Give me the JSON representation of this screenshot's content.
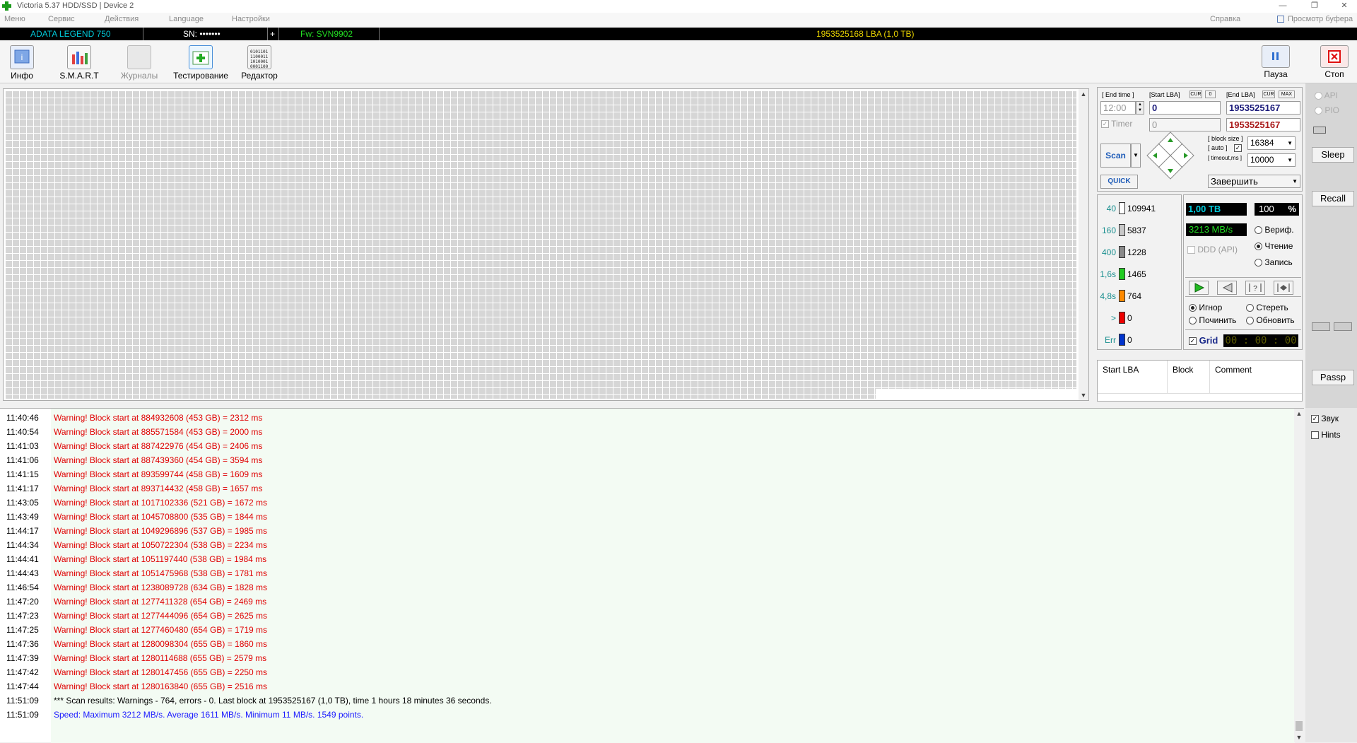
{
  "window": {
    "title": "Victoria 5.37 HDD/SSD | Device 2"
  },
  "menu": {
    "items": [
      "Меню",
      "Сервис",
      "Действия",
      "Language",
      "Настройки"
    ],
    "help": "Справка",
    "clipboard": "Просмотр буфера"
  },
  "device": {
    "model": "ADATA LEGEND 750",
    "sn": "SN: •••••••",
    "plus": "+",
    "fw": "Fw: SVN9902",
    "lba": "1953525168 LBA (1,0 TB)"
  },
  "toolbar": {
    "info": "Инфо",
    "smart": "S.M.A.R.T",
    "logs": "Журналы",
    "testing": "Тестирование",
    "editor": "Редактор",
    "pause": "Пауза",
    "stop": "Стоп"
  },
  "scan_panel": {
    "end_time_label": "[ End time ]",
    "start_lba_label": "[Start LBA]",
    "cur": "CUR",
    "zero": "0",
    "end_lba_label": "[End LBA]",
    "max": "MAX",
    "end_time": "12:00",
    "start_lba": "0",
    "end_lba": "1953525167",
    "timer_label": "Timer",
    "timer_value": "0",
    "end_lba2": "1953525167",
    "scan": "Scan",
    "quick": "QUICK",
    "block_size_label": "[ block size ]",
    "auto_label": "[ auto ]",
    "timeout_label": "[ timeout,ms ]",
    "block_size": "16384",
    "timeout": "10000",
    "finish": "Завершить"
  },
  "stats": [
    {
      "ms": "40",
      "count": "109941",
      "color": "#ffffff"
    },
    {
      "ms": "160",
      "count": "5837",
      "color": "#c8c8c8"
    },
    {
      "ms": "400",
      "count": "1228",
      "color": "#8a8a8a"
    },
    {
      "ms": "1,6s",
      "count": "1465",
      "color": "#22cc22"
    },
    {
      "ms": "4,8s",
      "count": "764",
      "color": "#ff8a00"
    },
    {
      "ms": ">",
      "count": "0",
      "color": "#ee0000"
    },
    {
      "ms": "Err",
      "count": "0",
      "color": "#0033cc"
    }
  ],
  "progress": {
    "size": "1,00 TB",
    "percent": "100",
    "pct_sign": "%",
    "speed": "3213 MB/s",
    "ddd": "DDD (API)"
  },
  "mode": {
    "verify": "Вериф.",
    "read": "Чтение",
    "write": "Запись"
  },
  "action": {
    "ignore": "Игнор",
    "erase": "Стереть",
    "repair": "Починить",
    "refresh": "Обновить"
  },
  "grid_label": "Grid",
  "timer_display": "00 : 00 : 00",
  "table": {
    "cols": [
      "Start LBA",
      "Block",
      "Comment"
    ]
  },
  "side": {
    "api": "API",
    "pio": "PIO",
    "sleep": "Sleep",
    "recall": "Recall",
    "passp": "Passp",
    "sound": "Звук",
    "hints": "Hints"
  },
  "log": [
    {
      "t": "11:40:46",
      "m": "Warning! Block start at 884932608 (453 GB)  = 2312 ms",
      "c": "#e00000"
    },
    {
      "t": "11:40:54",
      "m": "Warning! Block start at 885571584 (453 GB)  = 2000 ms",
      "c": "#e00000"
    },
    {
      "t": "11:41:03",
      "m": "Warning! Block start at 887422976 (454 GB)  = 2406 ms",
      "c": "#e00000"
    },
    {
      "t": "11:41:06",
      "m": "Warning! Block start at 887439360 (454 GB)  = 3594 ms",
      "c": "#e00000"
    },
    {
      "t": "11:41:15",
      "m": "Warning! Block start at 893599744 (458 GB)  = 1609 ms",
      "c": "#e00000"
    },
    {
      "t": "11:41:17",
      "m": "Warning! Block start at 893714432 (458 GB)  = 1657 ms",
      "c": "#e00000"
    },
    {
      "t": "11:43:05",
      "m": "Warning! Block start at 1017102336 (521 GB)  = 1672 ms",
      "c": "#e00000"
    },
    {
      "t": "11:43:49",
      "m": "Warning! Block start at 1045708800 (535 GB)  = 1844 ms",
      "c": "#e00000"
    },
    {
      "t": "11:44:17",
      "m": "Warning! Block start at 1049296896 (537 GB)  = 1985 ms",
      "c": "#e00000"
    },
    {
      "t": "11:44:34",
      "m": "Warning! Block start at 1050722304 (538 GB)  = 2234 ms",
      "c": "#e00000"
    },
    {
      "t": "11:44:41",
      "m": "Warning! Block start at 1051197440 (538 GB)  = 1984 ms",
      "c": "#e00000"
    },
    {
      "t": "11:44:43",
      "m": "Warning! Block start at 1051475968 (538 GB)  = 1781 ms",
      "c": "#e00000"
    },
    {
      "t": "11:46:54",
      "m": "Warning! Block start at 1238089728 (634 GB)  = 1828 ms",
      "c": "#e00000"
    },
    {
      "t": "11:47:20",
      "m": "Warning! Block start at 1277411328 (654 GB)  = 2469 ms",
      "c": "#e00000"
    },
    {
      "t": "11:47:23",
      "m": "Warning! Block start at 1277444096 (654 GB)  = 2625 ms",
      "c": "#e00000"
    },
    {
      "t": "11:47:25",
      "m": "Warning! Block start at 1277460480 (654 GB)  = 1719 ms",
      "c": "#e00000"
    },
    {
      "t": "11:47:36",
      "m": "Warning! Block start at 1280098304 (655 GB)  = 1860 ms",
      "c": "#e00000"
    },
    {
      "t": "11:47:39",
      "m": "Warning! Block start at 1280114688 (655 GB)  = 2579 ms",
      "c": "#e00000"
    },
    {
      "t": "11:47:42",
      "m": "Warning! Block start at 1280147456 (655 GB)  = 2250 ms",
      "c": "#e00000"
    },
    {
      "t": "11:47:44",
      "m": "Warning! Block start at 1280163840 (655 GB)  = 2516 ms",
      "c": "#e00000"
    },
    {
      "t": "11:51:09",
      "m": "*** Scan results: Warnings - 764, errors - 0. Last block at 1953525167 (1,0 TB), time 1 hours 18 minutes 36 seconds.",
      "c": "#000000"
    },
    {
      "t": "11:51:09",
      "m": "Speed: Maximum 3212 MB/s. Average 1611 MB/s. Minimum 11 MB/s. 1549 points.",
      "c": "#1a1aff"
    }
  ]
}
